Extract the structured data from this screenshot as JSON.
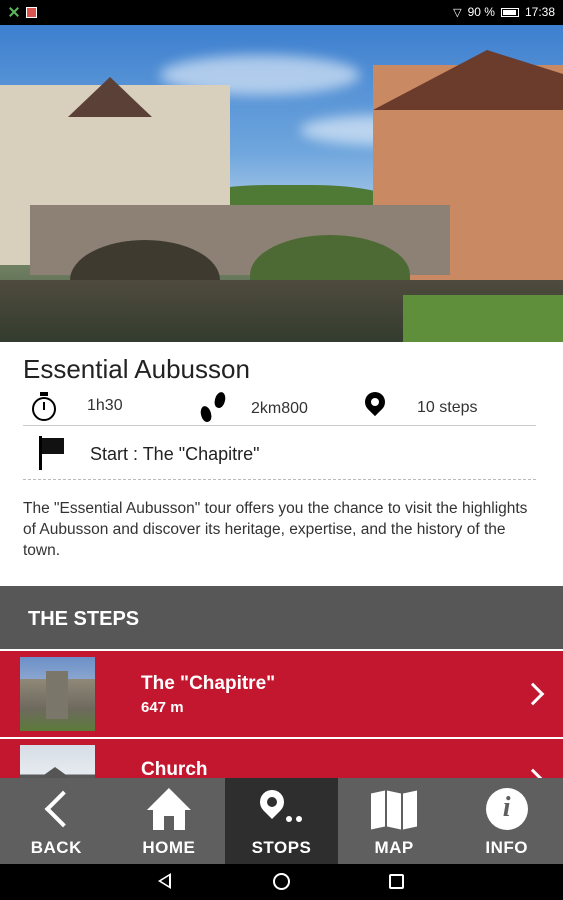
{
  "status_bar": {
    "battery": "90 %",
    "time": "17:38"
  },
  "tour": {
    "title": "Essential Aubusson",
    "duration": "1h30",
    "distance": "2km800",
    "steps_count": "10 steps",
    "start": "Start : The \"Chapitre\"",
    "description": "The \"Essential Aubusson\" tour offers you the chance to visit the highlights of Aubusson and discover its heritage, expertise, and the history of the town."
  },
  "steps_section": {
    "header": "THE STEPS",
    "items": [
      {
        "name": "The \"Chapitre\"",
        "distance": "647 m"
      },
      {
        "name": "Church",
        "distance": ""
      }
    ]
  },
  "bottom_nav": {
    "items": [
      {
        "label": "BACK",
        "icon": "back-arrow-icon"
      },
      {
        "label": "HOME",
        "icon": "home-icon"
      },
      {
        "label": "STOPS",
        "icon": "stops-icon",
        "active": true
      },
      {
        "label": "MAP",
        "icon": "map-icon"
      },
      {
        "label": "INFO",
        "icon": "info-icon"
      }
    ]
  },
  "colors": {
    "accent_red": "#c3162f",
    "nav_gray": "#5f5f5f",
    "nav_active": "#2e2e2e",
    "header_gray": "#575757"
  }
}
